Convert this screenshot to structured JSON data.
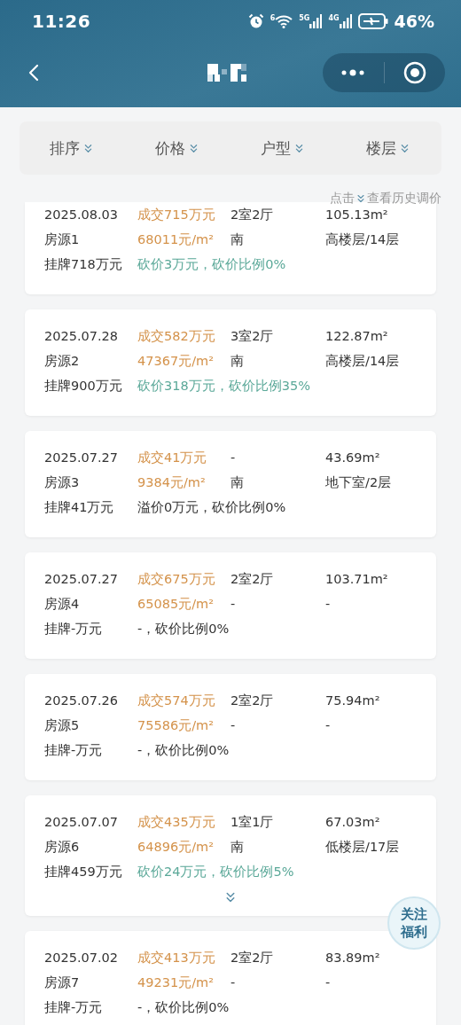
{
  "status_bar": {
    "time": "11:26",
    "wifi_label": "6",
    "networks": [
      "5G",
      "4G"
    ],
    "battery": "46%"
  },
  "filters": [
    {
      "label": "排序"
    },
    {
      "label": "价格"
    },
    {
      "label": "户型"
    },
    {
      "label": "楼层"
    }
  ],
  "hint": {
    "before": "点击",
    "after": "查看历史调价"
  },
  "records": [
    {
      "date": "2025.08.03",
      "source": "房源1",
      "listing": "挂牌718万元",
      "deal": "成交715万元",
      "unit_price": "68011元/m²",
      "note": {
        "text": "砍价3万元，砍价比例0%",
        "color": "#5aa898"
      },
      "layout": "2室2厅",
      "orientation": "南",
      "area": "105.13m²",
      "floor": "高楼层/14层",
      "expandable": false
    },
    {
      "date": "2025.07.28",
      "source": "房源2",
      "listing": "挂牌900万元",
      "deal": "成交582万元",
      "unit_price": "47367元/m²",
      "note": {
        "text": "砍价318万元，砍价比例35%",
        "color": "#5aa898"
      },
      "layout": "3室2厅",
      "orientation": "南",
      "area": "122.87m²",
      "floor": "高楼层/14层",
      "expandable": false
    },
    {
      "date": "2025.07.27",
      "source": "房源3",
      "listing": "挂牌41万元",
      "deal": "成交41万元",
      "unit_price": "9384元/m²",
      "note": {
        "text": "溢价0万元，砍价比例0%",
        "color": "#333333"
      },
      "layout": "-",
      "orientation": "南",
      "area": "43.69m²",
      "floor": "地下室/2层",
      "expandable": false
    },
    {
      "date": "2025.07.27",
      "source": "房源4",
      "listing": "挂牌-万元",
      "deal": "成交675万元",
      "unit_price": "65085元/m²",
      "note": {
        "text": "-，砍价比例0%",
        "color": "#333333"
      },
      "layout": "2室2厅",
      "orientation": "-",
      "area": "103.71m²",
      "floor": "-",
      "expandable": false
    },
    {
      "date": "2025.07.26",
      "source": "房源5",
      "listing": "挂牌-万元",
      "deal": "成交574万元",
      "unit_price": "75586元/m²",
      "note": {
        "text": "-，砍价比例0%",
        "color": "#333333"
      },
      "layout": "2室2厅",
      "orientation": "-",
      "area": "75.94m²",
      "floor": "-",
      "expandable": false
    },
    {
      "date": "2025.07.07",
      "source": "房源6",
      "listing": "挂牌459万元",
      "deal": "成交435万元",
      "unit_price": "64896元/m²",
      "note": {
        "text": "砍价24万元，砍价比例5%",
        "color": "#5aa898"
      },
      "layout": "1室1厅",
      "orientation": "南",
      "area": "67.03m²",
      "floor": "低楼层/17层",
      "expandable": true
    },
    {
      "date": "2025.07.02",
      "source": "房源7",
      "listing": "挂牌-万元",
      "deal": "成交413万元",
      "unit_price": "49231元/m²",
      "note": {
        "text": "-，砍价比例0%",
        "color": "#333333"
      },
      "layout": "2室2厅",
      "orientation": "-",
      "area": "83.89m²",
      "floor": "-",
      "expandable": false
    }
  ],
  "float_button": {
    "lines": [
      "关注",
      "福利"
    ]
  }
}
